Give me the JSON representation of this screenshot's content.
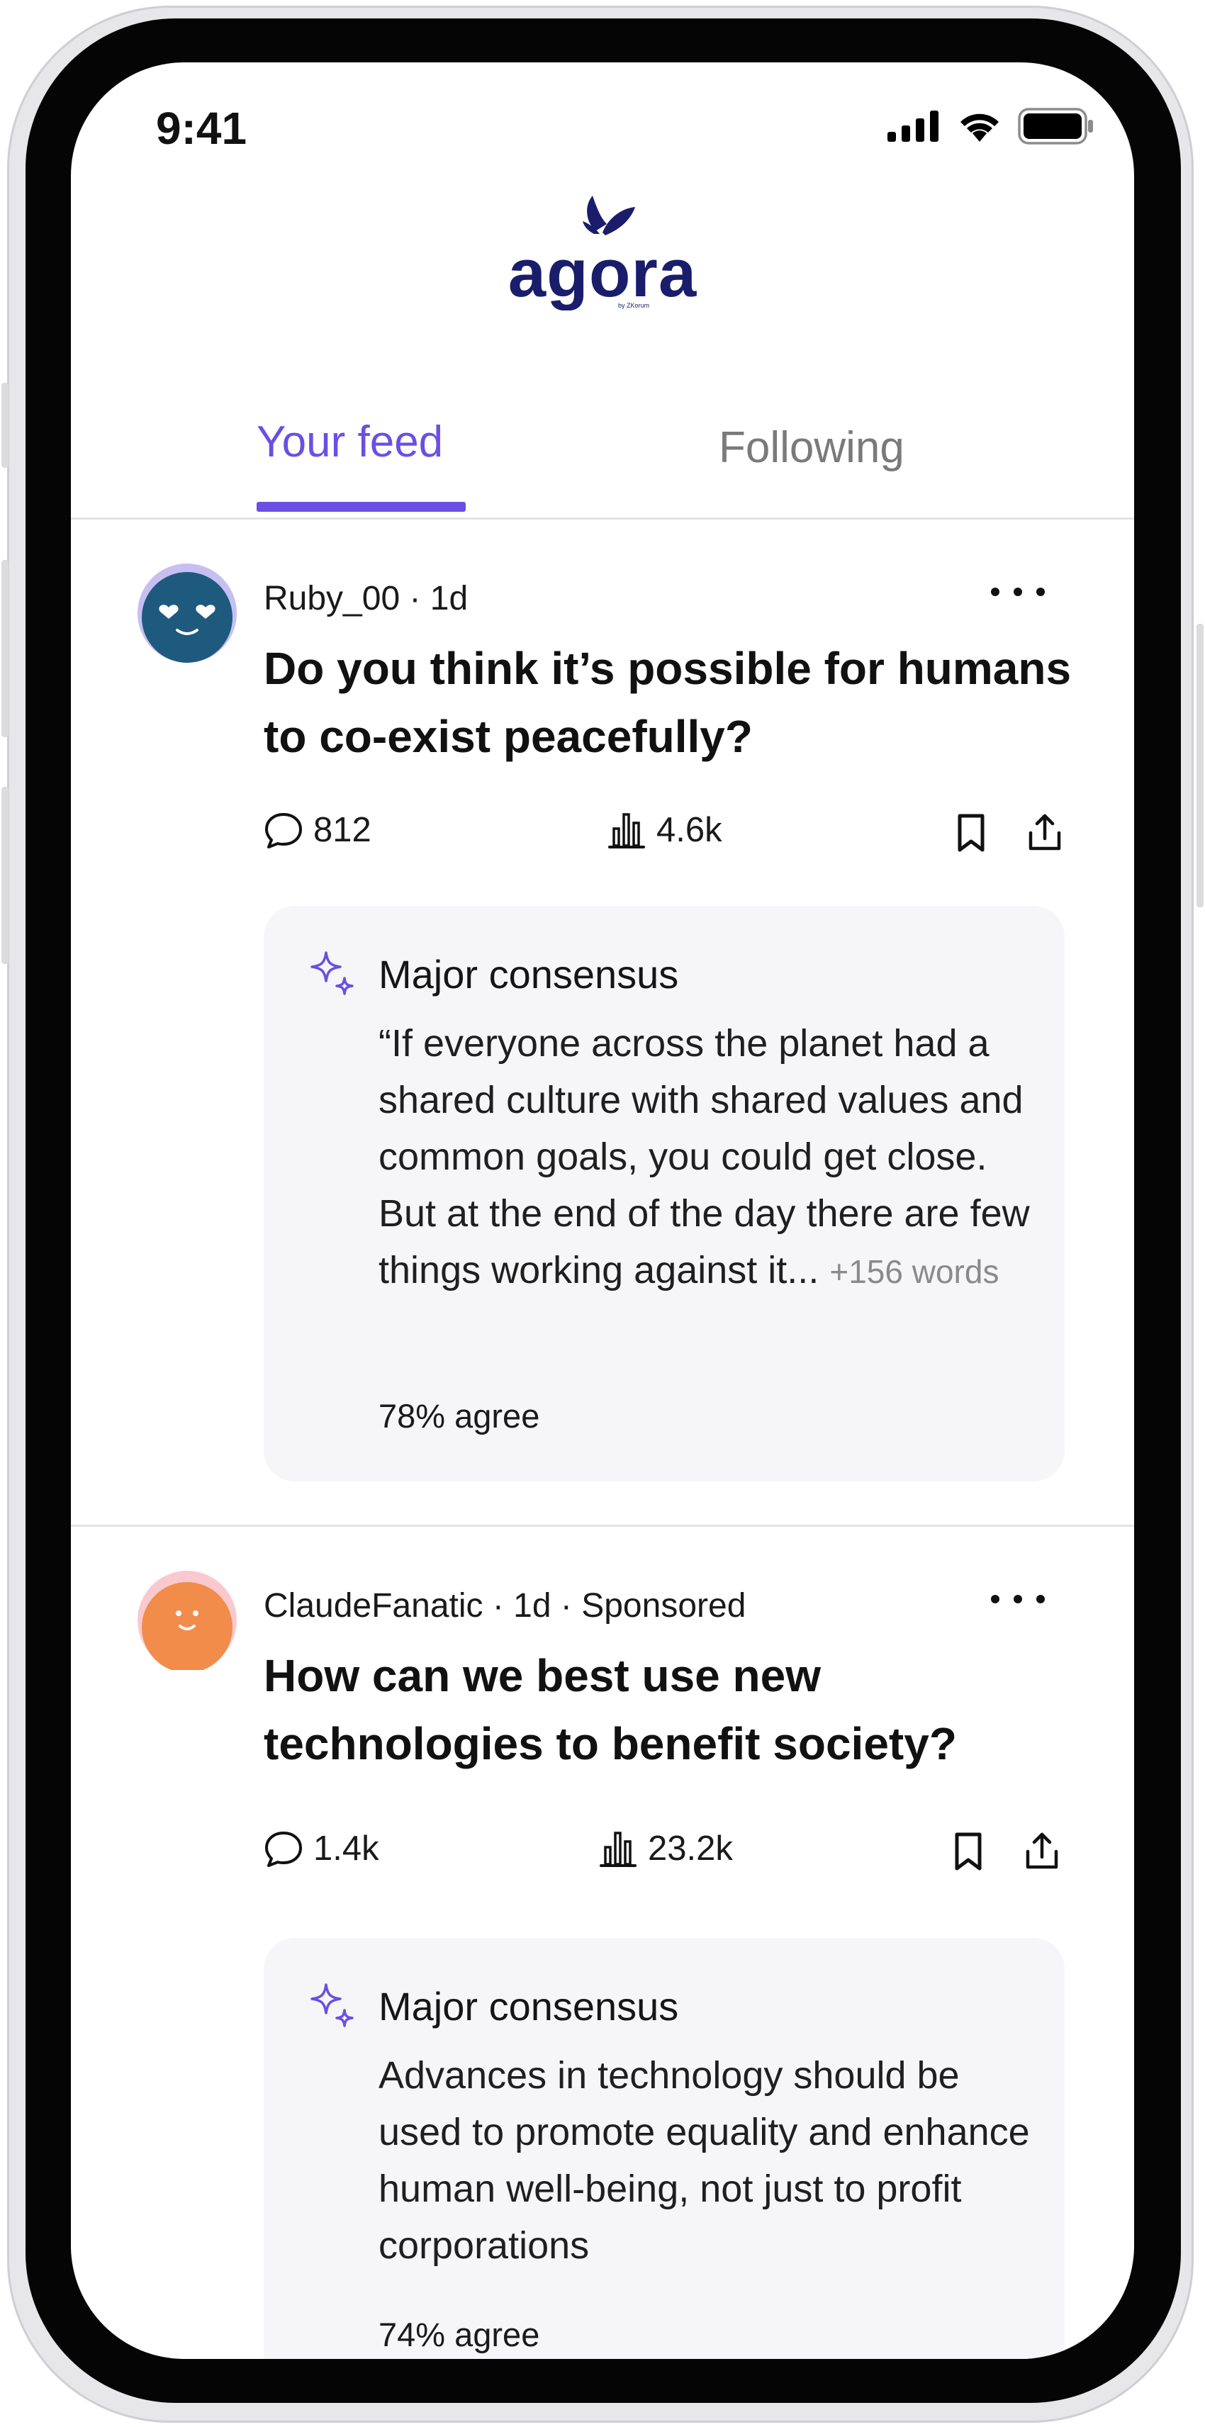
{
  "status_bar": {
    "time": "9:41"
  },
  "header": {
    "logo_text": "agora",
    "logo_byline": "by ZKorum"
  },
  "tabs": [
    {
      "label": "Your feed",
      "active": true
    },
    {
      "label": "Following",
      "active": false
    }
  ],
  "colors": {
    "accent": "#6b4fe3",
    "avatar_blue": "#1e5a7e",
    "avatar_orange": "#f28c4b",
    "card_bg": "#f6f6f8"
  },
  "posts": [
    {
      "author": "Ruby_00",
      "meta": "Ruby_00 · 1d",
      "avatar_icon": "heart-eyes-avatar-icon",
      "question": "Do you think it’s possible for humans to co-exist peacefully?",
      "comments": "812",
      "views": "4.6k",
      "consensus": {
        "title": "Major consensus",
        "text": "“If everyone across the planet had a shared culture with shared values and common goals, you could get close. But at the end of the day there are few things working against it...",
        "more_words": "+156 words",
        "agree": "78% agree"
      }
    },
    {
      "author": "ClaudeFanatic",
      "meta": "ClaudeFanatic · 1d · Sponsored",
      "avatar_icon": "smiley-avatar-icon",
      "question": "How can we best use new technologies to benefit society?",
      "comments": "1.4k",
      "views": "23.2k",
      "consensus": {
        "title": "Major consensus",
        "text": "Advances in technology should be used to promote equality and enhance human well-being, not just to profit corporations",
        "agree": "74% agree"
      }
    }
  ]
}
